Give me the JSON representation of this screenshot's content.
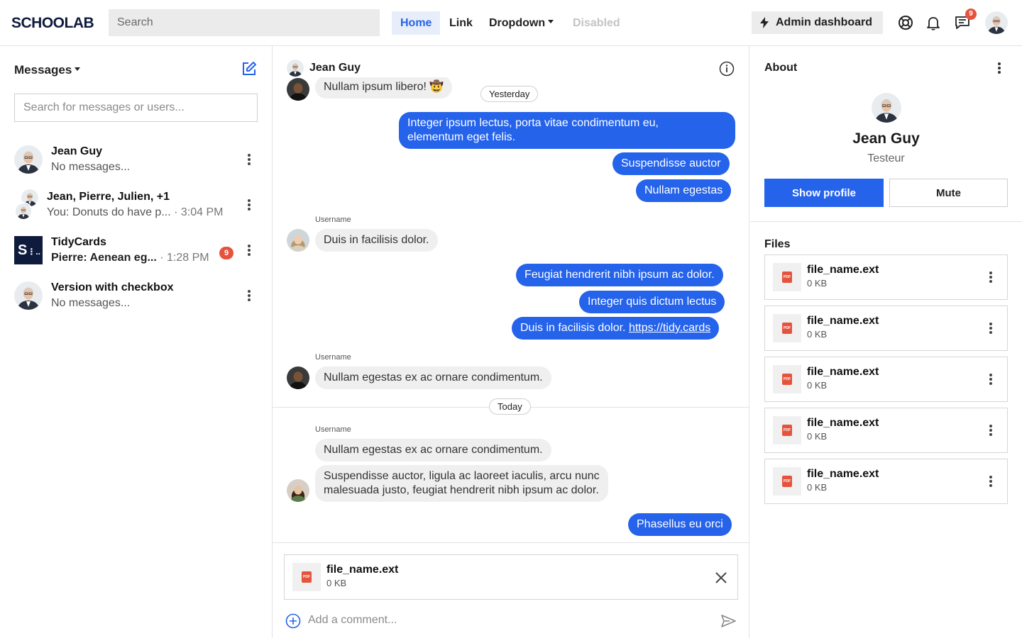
{
  "brand": {
    "logo_text": "SCHOOLAB"
  },
  "topbar": {
    "search_placeholder": "Search",
    "nav": {
      "home": "Home",
      "link": "Link",
      "dropdown": "Dropdown",
      "disabled": "Disabled"
    },
    "admin_label": "Admin dashboard",
    "notifications_badge": "9",
    "accent_color": "#2563eb"
  },
  "sidebar": {
    "title": "Messages",
    "search_placeholder": "Search for messages or users...",
    "conversations": [
      {
        "name": "Jean Guy",
        "preview": "No messages...",
        "time": ""
      },
      {
        "name": "Jean, Pierre, Julien, +1",
        "preview": "You: Donuts do have p...",
        "time": " · 3:04 PM"
      },
      {
        "name": "TidyCards",
        "preview": "Pierre: Aenean eg...",
        "time": " · 1:28 PM",
        "badge": "9"
      },
      {
        "name": "Version with checkbox",
        "preview": "No messages...",
        "time": ""
      }
    ]
  },
  "chat": {
    "header_name": "Jean Guy",
    "day_yesterday": "Yesterday",
    "day_today": "Today",
    "partial_message": "Nullam ipsum libero! 🤠",
    "out1": [
      "Integer ipsum lectus, porta vitae condimentum eu,",
      "elementum eget felis."
    ],
    "out2": "Suspendisse auctor",
    "out3": "Nullam egestas",
    "username": "Username",
    "in1": "Duis in facilisis dolor.",
    "out4": "Feugiat hendrerit nibh ipsum ac dolor.",
    "out5": "Integer quis dictum lectus",
    "out6_text": "Duis in facilisis dolor. ",
    "out6_link": "https://tidy.cards",
    "in2": "Nullam egestas ex ac ornare condimentum.",
    "in3": "Nullam egestas ex ac ornare condimentum.",
    "in4": [
      "Suspendisse auctor, ligula ac laoreet iaculis, arcu nunc",
      "malesuada justo, feugiat hendrerit nibh ipsum ac dolor."
    ],
    "out7": "Phasellus eu orci",
    "attachment": {
      "name": "file_name.ext",
      "size": "0 KB",
      "type": "PDF"
    },
    "comment_placeholder": "Add a comment..."
  },
  "about": {
    "title": "About",
    "name": "Jean Guy",
    "role": "Testeur",
    "show_profile": "Show profile",
    "mute": "Mute",
    "files_title": "Files",
    "files": [
      {
        "name": "file_name.ext",
        "size": "0 KB",
        "type": "PDF"
      },
      {
        "name": "file_name.ext",
        "size": "0 KB",
        "type": "PDF"
      },
      {
        "name": "file_name.ext",
        "size": "0 KB",
        "type": "PDF"
      },
      {
        "name": "file_name.ext",
        "size": "0 KB",
        "type": "PDF"
      },
      {
        "name": "file_name.ext",
        "size": "0 KB",
        "type": "PDF"
      }
    ]
  }
}
